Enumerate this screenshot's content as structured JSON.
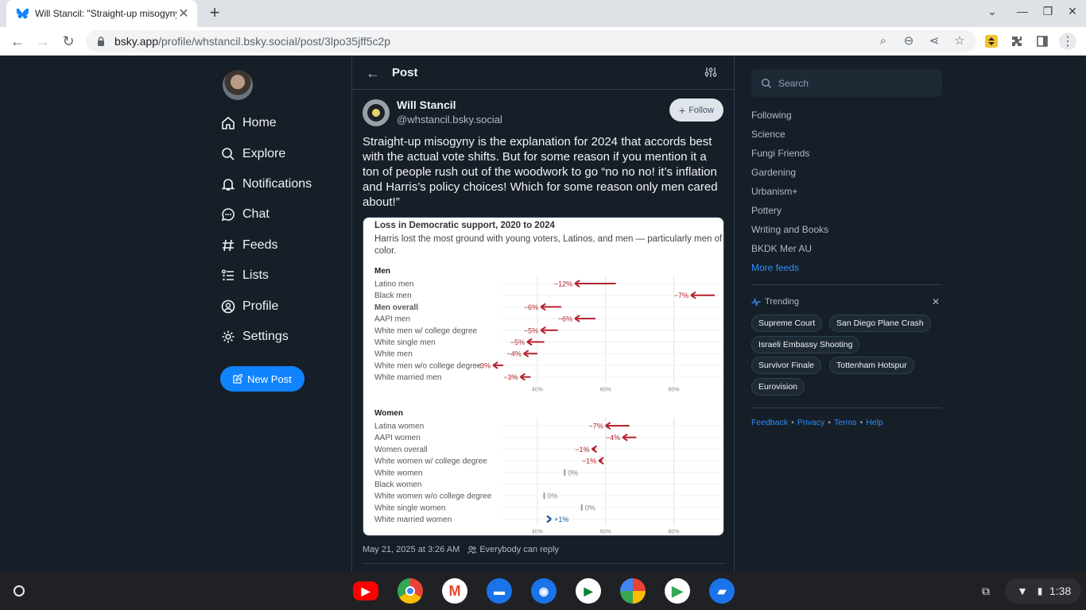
{
  "browser": {
    "tab_title": "Will Stancil: \"Straight-up misogyny",
    "url_host": "bsky.app",
    "url_path": "/profile/whstancil.bsky.social/post/3lpo35jff5c2p"
  },
  "left_nav": {
    "items": [
      {
        "label": "Home",
        "icon": "home-icon"
      },
      {
        "label": "Explore",
        "icon": "search-icon"
      },
      {
        "label": "Notifications",
        "icon": "bell-icon"
      },
      {
        "label": "Chat",
        "icon": "chat-bubble-icon"
      },
      {
        "label": "Feeds",
        "icon": "hash-icon"
      },
      {
        "label": "Lists",
        "icon": "list-icon"
      },
      {
        "label": "Profile",
        "icon": "user-circle-icon"
      },
      {
        "label": "Settings",
        "icon": "gear-icon"
      }
    ],
    "new_post_label": "New Post"
  },
  "post": {
    "header_title": "Post",
    "author_name": "Will Stancil",
    "author_handle": "@whstancil.bsky.social",
    "follow_label": "Follow",
    "text": "Straight-up misogyny is the explanation for 2024 that accords best with the actual vote shifts. But for some reason if you mention it a ton of people rush out of the woodwork to go “no no no! it’s inflation and Harris’s policy choices! Which for some reason only men cared about!”",
    "timestamp": "May 21, 2025 at 3:26 AM",
    "reply_setting": "Everybody can reply"
  },
  "chart_data": {
    "type": "arrow-dot",
    "title": "Loss in Democratic support, 2020 to 2024",
    "subtitle": "Harris lost the most ground with young voters, Latinos, and men — particularly men of color.",
    "x_ticks": [
      "40%",
      "60%",
      "80%"
    ],
    "xlim": [
      30,
      85
    ],
    "groups": [
      {
        "name": "Men",
        "rows": [
          {
            "label": "Latino men",
            "from": 63,
            "to": 51,
            "change_label": "−12%",
            "bold": false
          },
          {
            "label": "Black men",
            "from": 92,
            "to": 85,
            "change_label": "−7%",
            "bold": false
          },
          {
            "label": "Men overall",
            "from": 47,
            "to": 41,
            "change_label": "−6%",
            "bold": true
          },
          {
            "label": "AAPI men",
            "from": 57,
            "to": 51,
            "change_label": "−6%",
            "bold": false
          },
          {
            "label": "White men w/ college degree",
            "from": 46,
            "to": 41,
            "change_label": "−5%",
            "bold": false
          },
          {
            "label": "White single men",
            "from": 42,
            "to": 37,
            "change_label": "−5%",
            "bold": false
          },
          {
            "label": "White men",
            "from": 40,
            "to": 36,
            "change_label": "−4%",
            "bold": false
          },
          {
            "label": "White men w/o college degree",
            "from": 30,
            "to": 27,
            "change_label": "−3%",
            "bold": false
          },
          {
            "label": "White married men",
            "from": 38,
            "to": 35,
            "change_label": "−3%",
            "bold": false
          }
        ]
      },
      {
        "name": "Women",
        "rows": [
          {
            "label": "Latina women",
            "from": 67,
            "to": 60,
            "change_label": "−7%",
            "bold": false
          },
          {
            "label": "AAPI women",
            "from": 69,
            "to": 65,
            "change_label": "−4%",
            "bold": false
          },
          {
            "label": "Women overall",
            "from": 57,
            "to": 56,
            "change_label": "−1%",
            "bold": false
          },
          {
            "label": "White women w/ college degree",
            "from": 59,
            "to": 58,
            "change_label": "−1%",
            "bold": false
          },
          {
            "label": "White women",
            "from": 48,
            "to": 48,
            "change_label": "0%",
            "bold": false
          },
          {
            "label": "Black women",
            "from": 95,
            "to": 95,
            "change_label": "0%",
            "bold": false
          },
          {
            "label": "White women w/o college degree",
            "from": 42,
            "to": 42,
            "change_label": "0%",
            "bold": false
          },
          {
            "label": "White single women",
            "from": 53,
            "to": 53,
            "change_label": "0%",
            "bold": false
          },
          {
            "label": "White married women",
            "from": 43,
            "to": 44,
            "change_label": "+1%",
            "bold": false
          }
        ]
      }
    ],
    "colors": {
      "loss": "#b5212e",
      "gain": "#1f5b9c",
      "neutral": "#999999"
    }
  },
  "right_bar": {
    "search_placeholder": "Search",
    "feeds": [
      "Following",
      "Science",
      "Fungi Friends",
      "Gardening",
      "Urbanism+",
      "Pottery",
      "Writing and Books",
      "BKDK Mer AU"
    ],
    "more_feeds_label": "More feeds",
    "trending_title": "Trending",
    "trending": [
      "Supreme Court",
      "San Diego Plane Crash",
      "Israeli Embassy Shooting",
      "Survivor Finale",
      "Tottenham Hotspur",
      "Eurovision"
    ],
    "footer": [
      "Feedback",
      "Privacy",
      "Terms",
      "Help"
    ]
  },
  "shelf": {
    "time": "1:38",
    "apps": [
      "youtube-icon",
      "chrome-icon",
      "gmail-icon",
      "messages-icon",
      "camera-icon",
      "meet-icon",
      "photos-icon",
      "play-store-icon",
      "files-icon"
    ]
  },
  "colors": {
    "accent": "#1083fe",
    "bg": "#161e27"
  }
}
